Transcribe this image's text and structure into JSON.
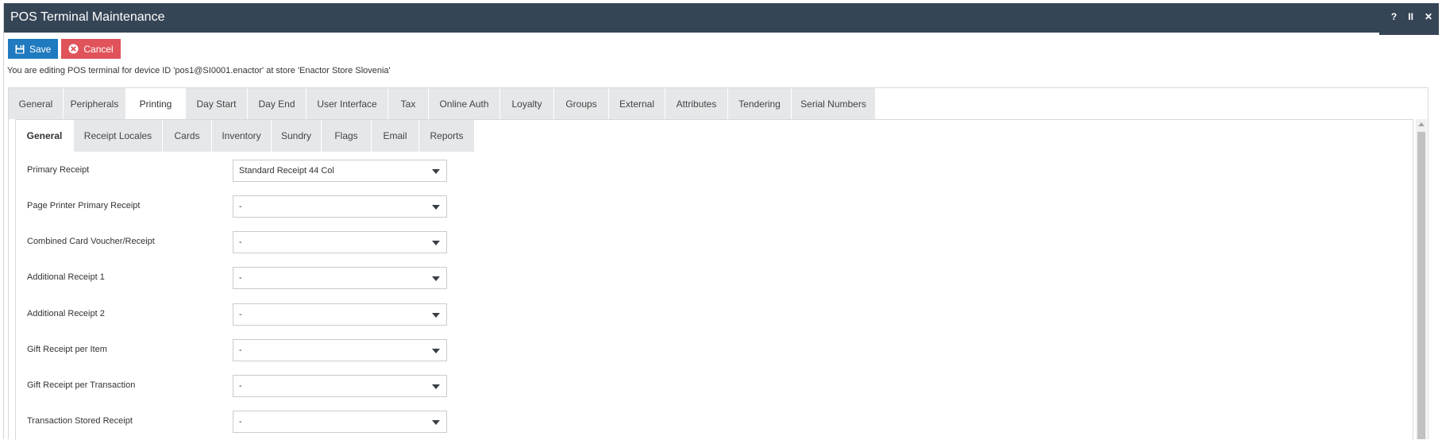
{
  "window": {
    "title": "POS Terminal Maintenance",
    "controls": {
      "help": "?",
      "pause": "II",
      "close": "✕"
    }
  },
  "toolbar": {
    "save_label": "Save",
    "cancel_label": "Cancel"
  },
  "info_text": "You are editing POS terminal for device ID 'pos1@SI0001.enactor' at store 'Enactor Store Slovenia'",
  "main_tabs": [
    {
      "label": "General",
      "active": false
    },
    {
      "label": "Peripherals",
      "active": false
    },
    {
      "label": "Printing",
      "active": true
    },
    {
      "label": "Day Start",
      "active": false
    },
    {
      "label": "Day End",
      "active": false
    },
    {
      "label": "User Interface",
      "active": false
    },
    {
      "label": "Tax",
      "active": false
    },
    {
      "label": "Online Auth",
      "active": false
    },
    {
      "label": "Loyalty",
      "active": false
    },
    {
      "label": "Groups",
      "active": false
    },
    {
      "label": "External",
      "active": false
    },
    {
      "label": "Attributes",
      "active": false
    },
    {
      "label": "Tendering",
      "active": false
    },
    {
      "label": "Serial Numbers",
      "active": false
    }
  ],
  "sub_tabs": [
    {
      "label": "General",
      "active": true
    },
    {
      "label": "Receipt Locales",
      "active": false
    },
    {
      "label": "Cards",
      "active": false
    },
    {
      "label": "Inventory",
      "active": false
    },
    {
      "label": "Sundry",
      "active": false
    },
    {
      "label": "Flags",
      "active": false
    },
    {
      "label": "Email",
      "active": false
    },
    {
      "label": "Reports",
      "active": false
    }
  ],
  "fields": [
    {
      "label": "Primary Receipt",
      "value": "Standard Receipt 44 Col"
    },
    {
      "label": "Page Printer Primary Receipt",
      "value": "-"
    },
    {
      "label": "Combined Card Voucher/Receipt",
      "value": "-"
    },
    {
      "label": "Additional Receipt 1",
      "value": "-"
    },
    {
      "label": "Additional Receipt 2",
      "value": "-"
    },
    {
      "label": "Gift Receipt per Item",
      "value": "-"
    },
    {
      "label": "Gift Receipt per Transaction",
      "value": "-"
    },
    {
      "label": "Transaction Stored Receipt",
      "value": "-"
    }
  ],
  "colors": {
    "titlebar": "#364556",
    "save_button": "#1f7abf",
    "cancel_button": "#e0535b",
    "tab_inactive": "#e6e7e8"
  }
}
